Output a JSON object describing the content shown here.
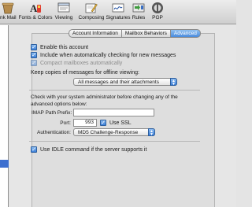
{
  "toolbar": {
    "items": [
      {
        "label": "nk Mail",
        "icon": "junk-mail-icon"
      },
      {
        "label": "Fonts & Colors",
        "icon": "fonts-colors-icon"
      },
      {
        "label": "Viewing",
        "icon": "viewing-icon"
      },
      {
        "label": "Composing",
        "icon": "composing-icon"
      },
      {
        "label": "Signatures",
        "icon": "signatures-icon"
      },
      {
        "label": "Rules",
        "icon": "rules-icon"
      },
      {
        "label": "PGP",
        "icon": "pgp-icon"
      }
    ]
  },
  "tabs": {
    "items": [
      {
        "label": "Account Information",
        "selected": false
      },
      {
        "label": "Mailbox Behaviors",
        "selected": false
      },
      {
        "label": "Advanced",
        "selected": true
      }
    ]
  },
  "advanced": {
    "enable_account": {
      "label": "Enable this account",
      "checked": true
    },
    "include_checking": {
      "label": "Include when automatically checking for new messages",
      "checked": true
    },
    "compact_mailboxes": {
      "label": "Compact mailboxes automatically",
      "checked": true,
      "disabled": true
    },
    "keep_copies_label": "Keep copies of messages for offline viewing:",
    "keep_copies_value": "All messages and their attachments",
    "admin_note": "Check with your system administrator before changing any of the advanced options below:",
    "imap_prefix_label": "IMAP Path Prefix:",
    "imap_prefix_value": "",
    "port_label": "Port:",
    "port_value": "993",
    "use_ssl": {
      "label": "Use SSL",
      "checked": true
    },
    "auth_label": "Authentication:",
    "auth_value": "MD5 Challenge-Response",
    "idle": {
      "label": "Use IDLE command if the server supports it",
      "checked": true
    }
  },
  "colors": {
    "accent": "#3c7fd8",
    "toolbar": "#dadada",
    "pane": "#e6e6e6"
  }
}
